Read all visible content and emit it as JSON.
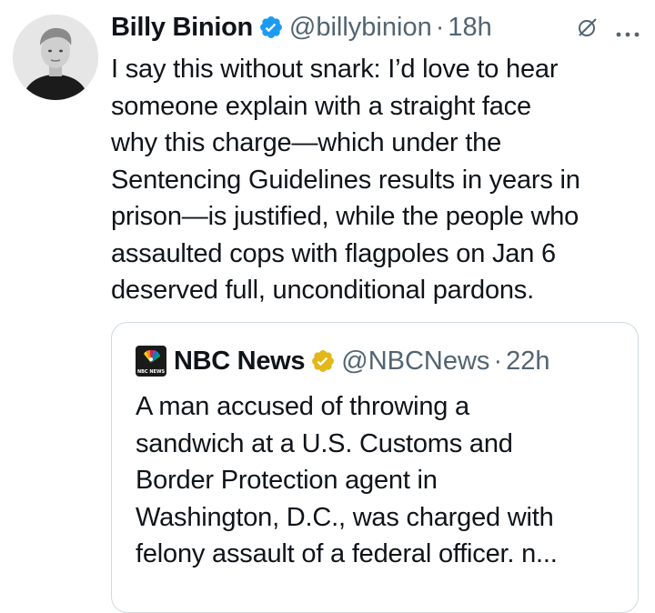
{
  "author": {
    "name": "Billy Binion",
    "handle": "@billybinion",
    "separator": "·",
    "time": "18h",
    "avatar_icon": "person-photo-avatar"
  },
  "tweet": {
    "text": "I say this without snark: I’d love to hear\nsomeone explain with a straight face\nwhy this charge—which under the\nSentencing Guidelines results in years in\nprison—is justified, while the people who\nassaulted cops with flagpoles on Jan 6\ndeserved full, unconditional pardons."
  },
  "quote": {
    "name": "NBC News",
    "handle": "@NBCNews",
    "separator": "·",
    "time": "22h",
    "logo_text": "NBC NEWS",
    "text": "A man accused of throwing a\nsandwich at a U.S. Customs and\nBorder Protection agent in\nWashington, D.C., was charged with\nfelony assault of a federal officer. n..."
  },
  "colors": {
    "text_primary": "#0f1419",
    "text_secondary": "#536471",
    "verified_blue": "#1d9bf0",
    "verified_gold": "#e2b719",
    "border": "#cfd9de"
  },
  "icons": {
    "verified": "verified-badge-icon",
    "grok": "grok-icon",
    "more": "more-options-icon"
  }
}
